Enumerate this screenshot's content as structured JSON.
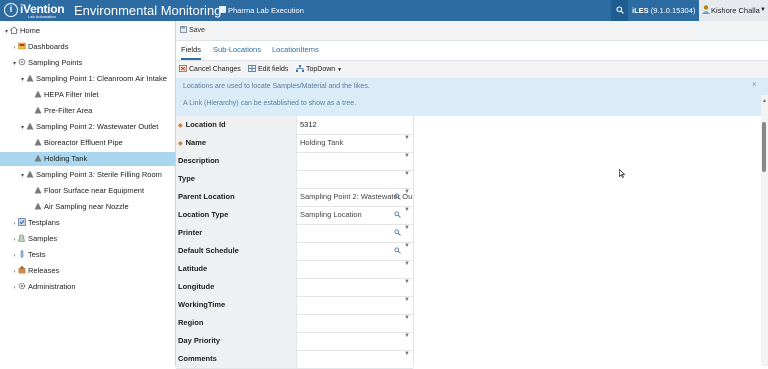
{
  "header": {
    "logo_name": "iVention",
    "logo_sub": "Lab Automation",
    "app_title": "Environmental Monitoring",
    "site": "Pharma Lab Execution",
    "version_label": "iLES",
    "version": "(9.1.0.15304)",
    "user": "Kishore Challa"
  },
  "tree": {
    "items": [
      {
        "label": "Home",
        "toggle": "▾"
      },
      {
        "label": "Dashboards",
        "toggle": "›"
      },
      {
        "label": "Sampling Points",
        "toggle": "▾"
      },
      {
        "label": "Sampling Point 1: Cleanroom Air Intake",
        "toggle": "▾"
      },
      {
        "label": "HEPA Filter Inlet",
        "toggle": ""
      },
      {
        "label": "Pre-Filter Area",
        "toggle": ""
      },
      {
        "label": "Sampling Point 2: Wastewater Outlet",
        "toggle": "▾"
      },
      {
        "label": "Bioreactor Effluent Pipe",
        "toggle": ""
      },
      {
        "label": "Holding Tank",
        "toggle": ""
      },
      {
        "label": "Sampling Point 3: Sterile Filling Room",
        "toggle": "▾"
      },
      {
        "label": "Floor Surface near Equipment",
        "toggle": ""
      },
      {
        "label": "Air Sampling near Nozzle",
        "toggle": ""
      },
      {
        "label": "Testplans",
        "toggle": "›"
      },
      {
        "label": "Samples",
        "toggle": "›"
      },
      {
        "label": "Tests",
        "toggle": "›"
      },
      {
        "label": "Releases",
        "toggle": "›"
      },
      {
        "label": "Administration",
        "toggle": "›"
      }
    ]
  },
  "toolbar": {
    "save": "Save"
  },
  "tabs": [
    {
      "label": "Fields"
    },
    {
      "label": "Sub-Locations"
    },
    {
      "label": "LocationItems"
    }
  ],
  "actions": {
    "cancel": "Cancel Changes",
    "edit": "Edit fields",
    "topdown": "TopDown"
  },
  "info": {
    "line1": "Locations are used to locate Samples/Material and the likes.",
    "line2": "A Link (Hierarchy) can be established to show as a tree.",
    "close": "×"
  },
  "form": {
    "fields": [
      {
        "label": "Location Id",
        "value": "5312",
        "required": "◆"
      },
      {
        "label": "Name",
        "value": "Holding Tank",
        "required": "◆"
      },
      {
        "label": "Description",
        "value": ""
      },
      {
        "label": "Type",
        "value": ""
      },
      {
        "label": "Parent Location",
        "value": "Sampling Point 2: Wastewater Ou"
      },
      {
        "label": "Location Type",
        "value": "Sampling Location"
      },
      {
        "label": "Printer",
        "value": ""
      },
      {
        "label": "Default Schedule",
        "value": ""
      },
      {
        "label": "Latitude",
        "value": ""
      },
      {
        "label": "Longitude",
        "value": ""
      },
      {
        "label": "WorkingTime",
        "value": ""
      },
      {
        "label": "Region",
        "value": ""
      },
      {
        "label": "Day Priority",
        "value": ""
      },
      {
        "label": "Comments",
        "value": ""
      }
    ]
  },
  "colors": {
    "header_bg": "#2d6ca3",
    "selected_row": "#aad7f0",
    "info_bg": "#d9ecf8",
    "required_marker": "#d9822b"
  }
}
